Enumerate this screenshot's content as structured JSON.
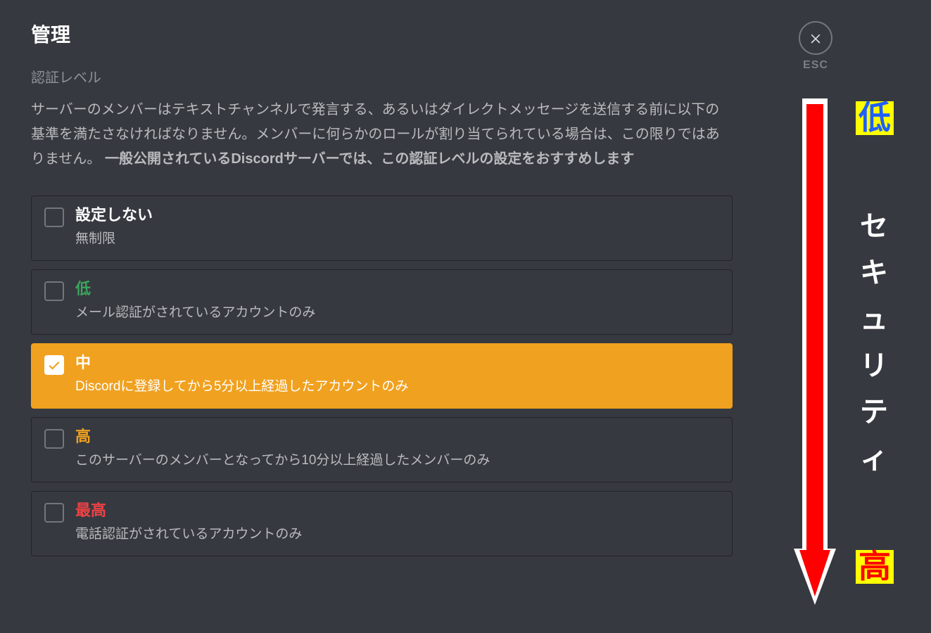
{
  "header": {
    "title": "管理",
    "close_label": "ESC"
  },
  "section": {
    "label": "認証レベル",
    "description_plain": "サーバーのメンバーはテキストチャンネルで発言する、あるいはダイレクトメッセージを送信する前に以下の基準を満たさなければなりません。メンバーに何らかのロールが割り当てられている場合は、この限りではありません。 ",
    "description_bold": "一般公開されているDiscordサーバーでは、この認証レベルの設定をおすすめします"
  },
  "options": [
    {
      "key": "none",
      "title": "設定しない",
      "desc": "無制限",
      "selected": false
    },
    {
      "key": "low",
      "title": "低",
      "desc": "メール認証がされているアカウントのみ",
      "selected": false
    },
    {
      "key": "medium",
      "title": "中",
      "desc": "Discordに登録してから5分以上経過したアカウントのみ",
      "selected": true
    },
    {
      "key": "high",
      "title": "高",
      "desc": "このサーバーのメンバーとなってから10分以上経過したメンバーのみ",
      "selected": false
    },
    {
      "key": "highest",
      "title": "最高",
      "desc": "電話認証がされているアカウントのみ",
      "selected": false
    }
  ],
  "annotation": {
    "top_tag": "低",
    "bottom_tag": "高",
    "vertical_label": "セキュリティ",
    "arrow_color": "#ff0000"
  }
}
